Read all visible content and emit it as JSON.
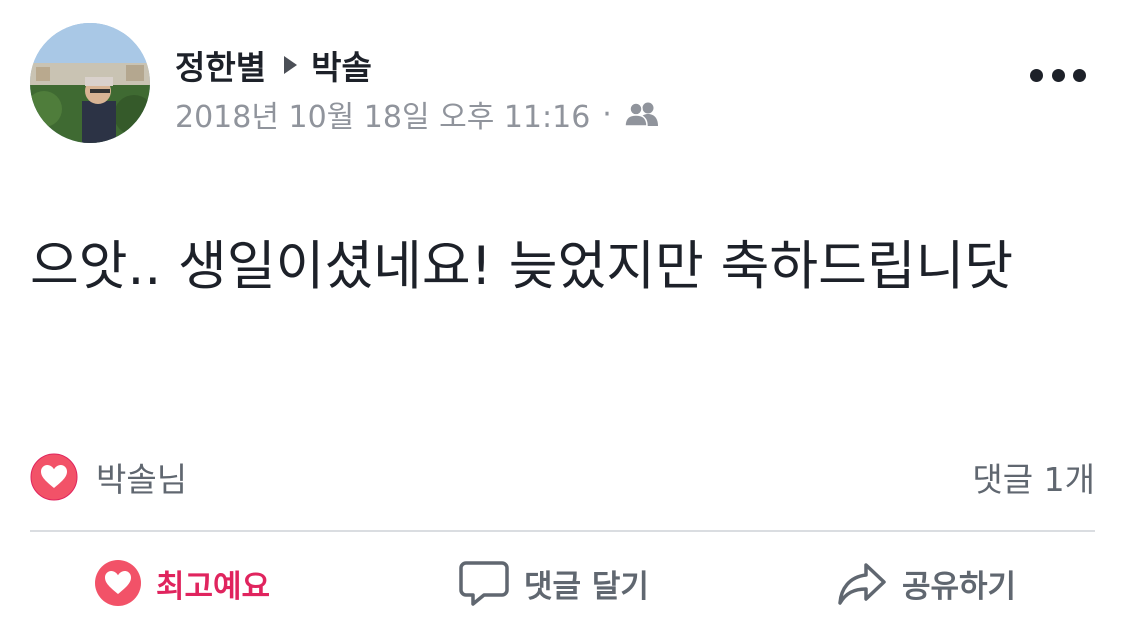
{
  "post": {
    "author": "정한별",
    "target": "박솔",
    "timestamp": "2018년 10월 18일 오후 11:16",
    "separator": "·",
    "privacy_icon": "friends-icon",
    "text": "으앗.. 생일이셨네요! 늦었지만 축하드립니닷"
  },
  "reactions": {
    "icon": "heart-reaction-icon",
    "reactors": "박솔님",
    "comment_count": "댓글 1개"
  },
  "actions": {
    "love_label": "최고예요",
    "comment_label": "댓글 달기",
    "share_label": "공유하기"
  },
  "colors": {
    "love": "#e0245e",
    "text": "#1d2129",
    "secondary": "#606770",
    "meta": "#90949c",
    "divider": "#dadde1"
  }
}
